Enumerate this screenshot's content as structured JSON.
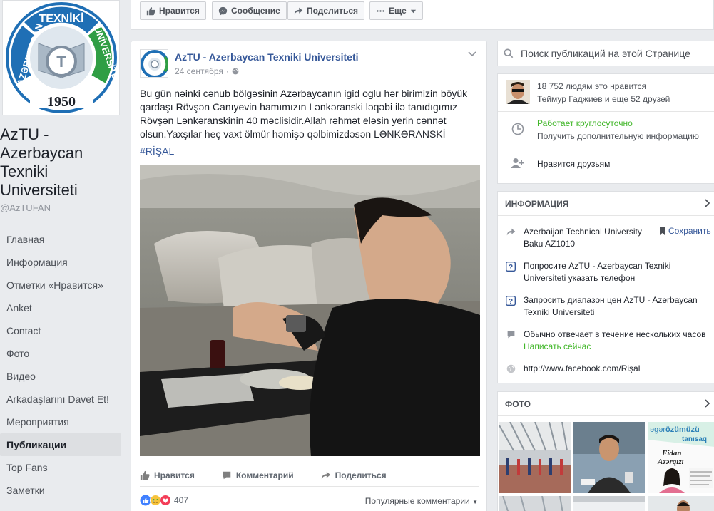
{
  "page": {
    "name": "AzTU - Azerbaycan Texniki Universiteti",
    "handle": "@AzTUFAN",
    "logo": {
      "top_text": "TEXNİKİ",
      "left_text": "AZƏRBAYCAN",
      "right_text": "UNİVERSİTETİ",
      "year": "1950"
    }
  },
  "nav": {
    "items": [
      {
        "label": "Главная"
      },
      {
        "label": "Информация"
      },
      {
        "label": "Отметки «Нравится»"
      },
      {
        "label": "Anket"
      },
      {
        "label": "Contact"
      },
      {
        "label": "Фото"
      },
      {
        "label": "Видео"
      },
      {
        "label": "Arkadaşlarını Davet Et!"
      },
      {
        "label": "Мероприятия"
      },
      {
        "label": "Публикации",
        "active": true
      },
      {
        "label": "Top Fans"
      },
      {
        "label": "Заметки"
      }
    ]
  },
  "topbar": {
    "like": "Нравится",
    "message": "Сообщение",
    "share": "Поделиться",
    "more": "Еще"
  },
  "post": {
    "author": "AzTU - Azerbaycan Texniki Universiteti",
    "date": "24 сентября",
    "text": "Bu gün nəinki cənub bölgəsinin Azərbaycanın igid oglu hər birimizin böyük qardaşı Rövşən Canıyevin hamımızın Lənkəranski ləqəbi ilə tanıdıgımız Rövşən Lənkəranskinin 40 məclisidir.Allah rəhmət eləsin yerin cənnət olsun.Yaxşılar heç vaxt ölmür həmişə qəlbimizdəsən LƏNKƏRANSKİ",
    "hashtag": "#RİŞAL",
    "actions": {
      "like": "Нравится",
      "comment": "Комментарий",
      "share": "Поделиться"
    },
    "reactions_count": "407",
    "sort_label": "Популярные комментарии"
  },
  "sidebar": {
    "search_placeholder": "Поиск публикаций на этой Странице",
    "likes_count_text": "18 752 людям это нравится",
    "likes_friends_text": "Теймур Гаджиев и еще 52 друзей",
    "hours_status": "Работает круглосуточно",
    "hours_more": "Получить дополнительную информацию",
    "friends_like": "Нравится друзьям",
    "info_title": "ИНФОРМАЦИЯ",
    "address_line1": "Azerbaijan Technical University",
    "address_line2": "Baku AZ1010",
    "save_label": "Сохранить",
    "ask_phone": "Попросите AzTU - Azerbaycan Texniki Universiteti указать телефон",
    "ask_price": "Запросить диапазон цен AzTU - Azerbaycan Texniki Universiteti",
    "response_time": "Обычно отвечает в течение нескольких часов",
    "write_now": "Написать сейчас",
    "website": "http://www.facebook.com/Rişal",
    "photo_title": "ФОТО",
    "photo3_text1": "əgər",
    "photo3_text2": "özümüzü",
    "photo3_text3": "tanısaq",
    "photo3_name1": "Fidan",
    "photo3_name2": "Azərqızı"
  },
  "colors": {
    "link": "#365899",
    "green": "#42b72a",
    "bg": "#e9ebee"
  }
}
